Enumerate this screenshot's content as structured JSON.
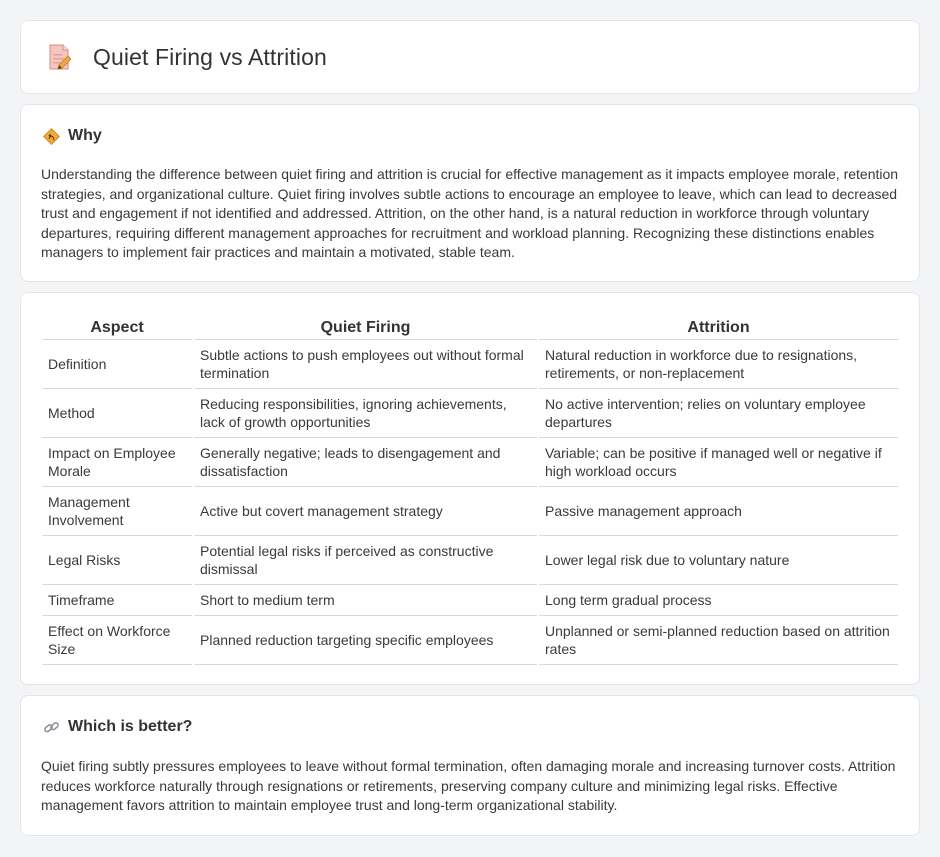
{
  "header": {
    "title": "Quiet Firing vs Attrition",
    "icon": "document-pencil-icon"
  },
  "why": {
    "heading": "Why",
    "icon": "diamond-sign-icon",
    "text": "Understanding the difference between quiet firing and attrition is crucial for effective management as it impacts employee morale, retention strategies, and organizational culture. Quiet firing involves subtle actions to encourage an employee to leave, which can lead to decreased trust and engagement if not identified and addressed. Attrition, on the other hand, is a natural reduction in workforce through voluntary departures, requiring different management approaches for recruitment and workload planning. Recognizing these distinctions enables managers to implement fair practices and maintain a motivated, stable team."
  },
  "comparison": {
    "headers": [
      "Aspect",
      "Quiet Firing",
      "Attrition"
    ],
    "rows": [
      [
        "Definition",
        "Subtle actions to push employees out without formal termination",
        "Natural reduction in workforce due to resignations, retirements, or non-replacement"
      ],
      [
        "Method",
        "Reducing responsibilities, ignoring achievements, lack of growth opportunities",
        "No active intervention; relies on voluntary employee departures"
      ],
      [
        "Impact on Employee Morale",
        "Generally negative; leads to disengagement and dissatisfaction",
        "Variable; can be positive if managed well or negative if high workload occurs"
      ],
      [
        "Management Involvement",
        "Active but covert management strategy",
        "Passive management approach"
      ],
      [
        "Legal Risks",
        "Potential legal risks if perceived as constructive dismissal",
        "Lower legal risk due to voluntary nature"
      ],
      [
        "Timeframe",
        "Short to medium term",
        "Long term gradual process"
      ],
      [
        "Effect on Workforce Size",
        "Planned reduction targeting specific employees",
        "Unplanned or semi-planned reduction based on attrition rates"
      ]
    ]
  },
  "better": {
    "heading": "Which is better?",
    "icon": "link-icon",
    "text": "Quiet firing subtly pressures employees to leave without formal termination, often damaging morale and increasing turnover costs. Attrition reduces workforce naturally through resignations or retirements, preserving company culture and minimizing legal risks. Effective management favors attrition to maintain employee trust and long-term organizational stability."
  },
  "colors": {
    "background": "#f3f4f6",
    "card": "#ffffff",
    "accent_orange": "#f0a93b",
    "icon_pink": "#e58a8a"
  }
}
